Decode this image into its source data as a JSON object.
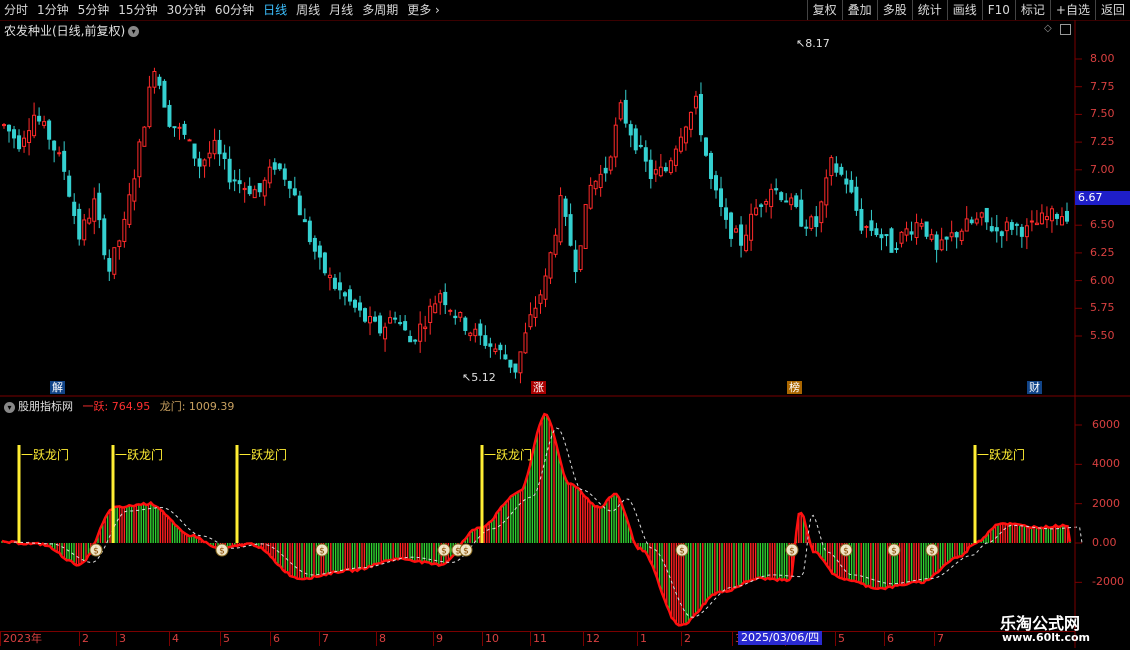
{
  "toolbar": {
    "periods": [
      "分时",
      "1分钟",
      "5分钟",
      "15分钟",
      "30分钟",
      "60分钟",
      "日线",
      "周线",
      "月线",
      "多周期",
      "更多 ›"
    ],
    "active_period": "日线",
    "actions": [
      "复权",
      "叠加",
      "多股",
      "统计",
      "画线",
      "F10",
      "标记",
      "+自选",
      "返回"
    ]
  },
  "main": {
    "title": "农发种业(日线,前复权)",
    "high_label": "8.17",
    "low_label": "5.12",
    "price_badge": "6.67",
    "y_ticks": [
      "8.00",
      "7.75",
      "7.50",
      "7.25",
      "7.00",
      "6.75",
      "6.50",
      "6.25",
      "6.00",
      "5.75",
      "5.50"
    ],
    "event_markers": [
      "解",
      "涨",
      "榜",
      "财"
    ]
  },
  "indicator": {
    "name": "股朋指标网",
    "label1": "一跃: 764.95",
    "label2": "龙门: 1009.39",
    "y_ticks": [
      "6000",
      "4000",
      "2000",
      "0.00",
      "-2000"
    ],
    "signal_text": "一跃龙门"
  },
  "time_axis": {
    "labels": [
      "2023年",
      "2",
      "3",
      "4",
      "5",
      "6",
      "7",
      "8",
      "9",
      "10",
      "11",
      "12",
      "1",
      "2",
      "3",
      "4",
      "5",
      "6",
      "7"
    ],
    "selected_date": "2025/03/06/四"
  },
  "watermark": {
    "line1": "乐淘公式网",
    "line2": "www.60lt.com"
  },
  "colors": {
    "up": "#ff2a2a",
    "down": "#35d0d0",
    "ind_up": "#ff2020",
    "ind_down": "#30d030",
    "axis": "#d84040",
    "signal": "#ffee33"
  },
  "chart_data": {
    "type": "candlestick",
    "ylim": [
      5.12,
      8.17
    ],
    "series": [
      {
        "name": "price_close",
        "values": [
          7.4,
          7.25,
          7.5,
          7.3,
          7.0,
          6.4,
          6.7,
          6.1,
          6.5,
          7.2,
          7.95,
          7.45,
          7.3,
          7.05,
          7.2,
          6.95,
          6.85,
          6.8,
          7.05,
          6.9,
          6.5,
          6.15,
          5.95,
          5.8,
          5.65,
          5.55,
          5.7,
          5.45,
          5.65,
          5.9,
          5.7,
          5.55,
          5.45,
          5.35,
          5.2,
          5.65,
          6.0,
          6.7,
          6.15,
          6.85,
          7.0,
          7.55,
          7.25,
          6.95,
          7.0,
          7.35,
          7.6,
          6.9,
          6.5,
          6.35,
          6.65,
          6.85,
          6.75,
          6.55,
          6.5,
          7.05,
          6.9,
          6.5,
          6.45,
          6.3,
          6.45,
          6.55,
          6.25,
          6.4,
          6.5,
          6.55,
          6.45,
          6.5,
          6.45,
          6.55,
          6.6
        ]
      }
    ]
  }
}
